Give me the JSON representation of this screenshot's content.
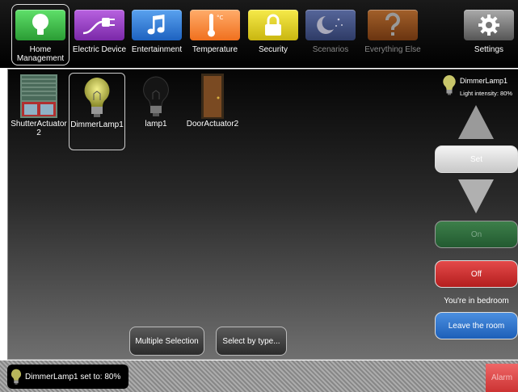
{
  "categories": [
    {
      "label": "Home Management",
      "icon": "lightbulb-icon",
      "color": "#3fbf4a",
      "selected": true
    },
    {
      "label": "Electric Device",
      "icon": "plug-icon",
      "color": "#9b3fc8"
    },
    {
      "label": "Entertainment",
      "icon": "music-note-icon",
      "color": "#2f7fd8"
    },
    {
      "label": "Temperature",
      "icon": "thermometer-icon",
      "color": "#ff8a3a"
    },
    {
      "label": "Security",
      "icon": "padlock-icon",
      "color": "#e6d21a"
    },
    {
      "label": "Scenarios",
      "icon": "moon-stars-icon",
      "color": "#3a4a78",
      "dimmed": true
    },
    {
      "label": "Everything Else",
      "icon": "question-mark-icon",
      "color": "#8a4a1a",
      "dimmed": true
    },
    {
      "label": "Settings",
      "icon": "gear-icon",
      "color": "#888888"
    }
  ],
  "devices": [
    {
      "label": "ShutterActuator2",
      "icon": "shutter-icon"
    },
    {
      "label": "DimmerLamp1",
      "icon": "lightbulb-on-icon",
      "selected": true
    },
    {
      "label": "lamp1",
      "icon": "lightbulb-off-icon"
    },
    {
      "label": "DoorActuator2",
      "icon": "door-icon"
    }
  ],
  "device_status": {
    "name": "DimmerLamp1",
    "intensity_text": "Light intensity: 80%",
    "intensity_percent": 80
  },
  "controls": {
    "set_label": "Set",
    "on_label": "On",
    "off_label": "Off",
    "room_text": "You're in bedroom",
    "leave_label": "Leave the room"
  },
  "bottom_buttons": {
    "multiple_selection": "Multiple Selection",
    "select_by_type": "Select by type..."
  },
  "footer": {
    "notification": "DimmerLamp1 set to: 80%",
    "alarm_label": "Alarm"
  }
}
